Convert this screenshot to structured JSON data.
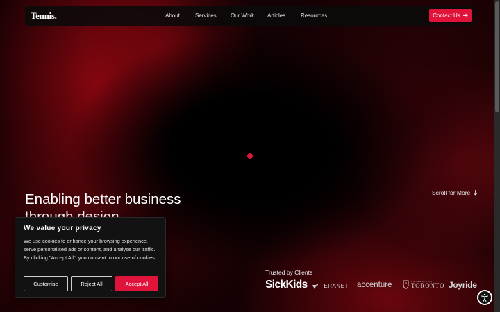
{
  "nav": {
    "logo": "Tennis.",
    "links": [
      "About",
      "Services",
      "Our Work",
      "Articles",
      "Resources"
    ],
    "cta": "Contact Us"
  },
  "hero": {
    "title": "Enabling better business through design",
    "scroll_label": "Scroll for More"
  },
  "clients": {
    "heading": "Trusted by Clients",
    "logos": [
      "SickKids",
      "TERANET",
      "accenture",
      "UNIVERSITY OF TORONTO",
      "Joyride"
    ],
    "toronto_small": "UNIVERSITY OF",
    "toronto_big": "TORONTO"
  },
  "cookie": {
    "title": "We value your privacy",
    "text": "We use cookies to enhance your browsing experience, serve personalised ads or content, and analyse our traffic. By clicking \"Accept All\", you consent to our use of cookies.",
    "customise": "Customise",
    "reject": "Reject All",
    "accept": "Accept All"
  },
  "colors": {
    "accent": "#e0133b",
    "background": "#140103",
    "panel": "#121212"
  },
  "icons": {
    "contact_arrow": "arrow-right-icon",
    "scroll_arrow": "arrow-down-icon",
    "accessibility": "accessibility-icon"
  }
}
